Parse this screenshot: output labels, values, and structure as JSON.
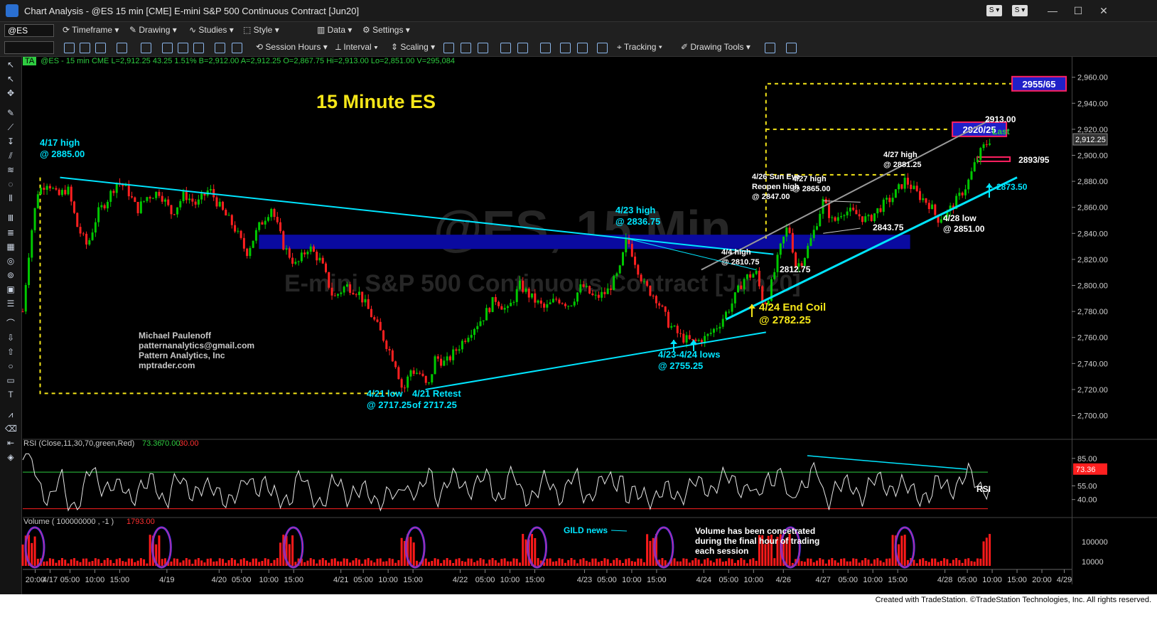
{
  "window": {
    "title": "Chart Analysis - @ES 15 min [CME] E-mini S&P 500 Continuous Contract [Jun20]"
  },
  "toolbar1": {
    "symbol": "@ES",
    "timeframe": "Timeframe",
    "drawing": "Drawing",
    "studies": "Studies",
    "style": "Style",
    "data": "Data",
    "settings": "Settings"
  },
  "toolbar2": {
    "session_hours": "Session Hours",
    "interval": "Interval",
    "scaling": "Scaling",
    "tracking": "Tracking",
    "drawing_tools": "Drawing Tools"
  },
  "status": {
    "tag": "TA",
    "text": "@ES - 15 min  CME  L=2,912.25  43.25  1.51%  B=2,912.00  A=2,912.25  O=2,867.75  Hi=2,913.00  Lo=2,851.00  V=295,084"
  },
  "footer": {
    "credit": "Created with TradeStation. ©TradeStation Technologies, Inc. All rights reserved."
  },
  "chart_data": [
    {
      "type": "line",
      "title": "15 Minute ES",
      "watermark_symbol": "@ES, 15 Min",
      "watermark_name": "E-mini S&P 500 Continuous Contract [Jun20]",
      "colors": {
        "up": "#00c800",
        "down": "#ff2020",
        "trendline": "#00e5ff",
        "zone": "#0a0aa0",
        "target": "#f5e619",
        "annotation": "#00e5ff"
      },
      "ylim": [
        2685,
        2968
      ],
      "y_ticks": [
        "2,960.00",
        "2,940.00",
        "2,920.00",
        "2,900.00",
        "2,880.00",
        "2,860.00",
        "2,840.00",
        "2,820.00",
        "2,800.00",
        "2,780.00",
        "2,760.00",
        "2,740.00",
        "2,720.00",
        "2,700.00"
      ],
      "y_tick_values": [
        2960,
        2940,
        2920,
        2900,
        2880,
        2860,
        2840,
        2820,
        2800,
        2780,
        2760,
        2740,
        2720,
        2700
      ],
      "x_ticks": [
        {
          "label": "20:00",
          "x": 0.05
        },
        {
          "label": "4/17",
          "x": 0.11
        },
        {
          "label": "05:00",
          "x": 0.19
        },
        {
          "label": "10:00",
          "x": 0.29
        },
        {
          "label": "15:00",
          "x": 0.39
        },
        {
          "label": "4/19",
          "x": 0.58
        },
        {
          "label": "4/20",
          "x": 0.79
        },
        {
          "label": "05:00",
          "x": 0.88
        },
        {
          "label": "10:00",
          "x": 0.99
        },
        {
          "label": "15:00",
          "x": 1.09
        },
        {
          "label": "4/21",
          "x": 1.28
        },
        {
          "label": "05:00",
          "x": 1.37
        },
        {
          "label": "10:00",
          "x": 1.47
        },
        {
          "label": "15:00",
          "x": 1.57
        },
        {
          "label": "4/22",
          "x": 1.76
        },
        {
          "label": "05:00",
          "x": 1.86
        },
        {
          "label": "10:00",
          "x": 1.96
        },
        {
          "label": "15:00",
          "x": 2.06
        },
        {
          "label": "4/23",
          "x": 2.26
        },
        {
          "label": "05:00",
          "x": 2.35
        },
        {
          "label": "10:00",
          "x": 2.45
        },
        {
          "label": "15:00",
          "x": 2.55
        },
        {
          "label": "4/24",
          "x": 2.74
        },
        {
          "label": "05:00",
          "x": 2.84
        },
        {
          "label": "10:00",
          "x": 2.94
        },
        {
          "label": "4/26",
          "x": 3.06
        },
        {
          "label": "4/27",
          "x": 3.22
        },
        {
          "label": "05:00",
          "x": 3.32
        },
        {
          "label": "10:00",
          "x": 3.42
        },
        {
          "label": "15:00",
          "x": 3.52
        },
        {
          "label": "4/28",
          "x": 3.71
        },
        {
          "label": "05:00",
          "x": 3.8
        },
        {
          "label": "10:00",
          "x": 3.9
        },
        {
          "label": "15:00",
          "x": 4.0
        },
        {
          "label": "20:00",
          "x": 4.1
        },
        {
          "label": "4/29",
          "x": 4.19
        }
      ],
      "price_path": [
        [
          0.0,
          2780
        ],
        [
          0.03,
          2835
        ],
        [
          0.06,
          2872
        ],
        [
          0.1,
          2880
        ],
        [
          0.14,
          2868
        ],
        [
          0.18,
          2875
        ],
        [
          0.22,
          2845
        ],
        [
          0.26,
          2830
        ],
        [
          0.3,
          2855
        ],
        [
          0.34,
          2866
        ],
        [
          0.38,
          2880
        ],
        [
          0.42,
          2874
        ],
        [
          0.46,
          2858
        ],
        [
          0.5,
          2868
        ],
        [
          0.55,
          2872
        ],
        [
          0.6,
          2855
        ],
        [
          0.65,
          2870
        ],
        [
          0.7,
          2862
        ],
        [
          0.75,
          2874
        ],
        [
          0.8,
          2858
        ],
        [
          0.85,
          2845
        ],
        [
          0.9,
          2825
        ],
        [
          0.95,
          2845
        ],
        [
          1.0,
          2860
        ],
        [
          1.05,
          2830
        ],
        [
          1.1,
          2815
        ],
        [
          1.15,
          2830
        ],
        [
          1.2,
          2818
        ],
        [
          1.25,
          2790
        ],
        [
          1.3,
          2800
        ],
        [
          1.35,
          2795
        ],
        [
          1.4,
          2778
        ],
        [
          1.45,
          2760
        ],
        [
          1.5,
          2740
        ],
        [
          1.53,
          2718
        ],
        [
          1.56,
          2735
        ],
        [
          1.6,
          2732
        ],
        [
          1.63,
          2720
        ],
        [
          1.66,
          2745
        ],
        [
          1.7,
          2740
        ],
        [
          1.75,
          2752
        ],
        [
          1.8,
          2765
        ],
        [
          1.85,
          2775
        ],
        [
          1.9,
          2790
        ],
        [
          1.95,
          2780
        ],
        [
          2.0,
          2800
        ],
        [
          2.05,
          2790
        ],
        [
          2.1,
          2782
        ],
        [
          2.15,
          2790
        ],
        [
          2.2,
          2785
        ],
        [
          2.25,
          2800
        ],
        [
          2.3,
          2790
        ],
        [
          2.35,
          2795
        ],
        [
          2.4,
          2810
        ],
        [
          2.43,
          2837
        ],
        [
          2.47,
          2815
        ],
        [
          2.5,
          2800
        ],
        [
          2.55,
          2790
        ],
        [
          2.6,
          2770
        ],
        [
          2.65,
          2760
        ],
        [
          2.7,
          2756
        ],
        [
          2.75,
          2760
        ],
        [
          2.8,
          2770
        ],
        [
          2.85,
          2785
        ],
        [
          2.9,
          2805
        ],
        [
          2.95,
          2810
        ],
        [
          2.98,
          2785
        ],
        [
          3.0,
          2792
        ],
        [
          3.05,
          2830
        ],
        [
          3.08,
          2847
        ],
        [
          3.11,
          2815
        ],
        [
          3.14,
          2820
        ],
        [
          3.18,
          2840
        ],
        [
          3.22,
          2865
        ],
        [
          3.26,
          2848
        ],
        [
          3.3,
          2858
        ],
        [
          3.35,
          2855
        ],
        [
          3.4,
          2850
        ],
        [
          3.45,
          2860
        ],
        [
          3.5,
          2868
        ],
        [
          3.55,
          2881
        ],
        [
          3.6,
          2870
        ],
        [
          3.65,
          2862
        ],
        [
          3.68,
          2851
        ],
        [
          3.72,
          2856
        ],
        [
          3.76,
          2866
        ],
        [
          3.8,
          2878
        ],
        [
          3.83,
          2893
        ],
        [
          3.86,
          2905
        ],
        [
          3.89,
          2912
        ]
      ],
      "zones": [
        {
          "y_low": 2828,
          "y_high": 2839,
          "x_start": 0.95,
          "x_end": 3.57
        }
      ],
      "trendlines": [
        {
          "name": "upper downtrend",
          "from": [
            0.15,
            2883
          ],
          "to": [
            3.02,
            2824
          ]
        },
        {
          "name": "lower uptrend",
          "from": [
            1.62,
            2720
          ],
          "to": [
            2.99,
            2764
          ]
        },
        {
          "name": "steep uptrend",
          "from": [
            2.83,
            2774
          ],
          "to": [
            4.0,
            2883
          ]
        },
        {
          "name": "upper channel",
          "from": [
            2.73,
            2812
          ],
          "to": [
            3.89,
            2927
          ]
        }
      ],
      "targets": [
        {
          "label": "2955/65",
          "y": 2955
        },
        {
          "label": "2920/25",
          "y": 2920
        },
        {
          "label": "2893/95",
          "y": 2897
        }
      ],
      "annotations": [
        {
          "text": "4/17 high\n@ 2885.00",
          "x": 0.15,
          "y": 2885
        },
        {
          "text": "4/21 low\n@ 2717.25",
          "x": 1.53,
          "y": 2717.25
        },
        {
          "text": "4/21 Retest\nof 2717.25",
          "x": 1.63,
          "y": 2717.25
        },
        {
          "text": "4/23 high\n@ 2836.75",
          "x": 2.43,
          "y": 2836.75
        },
        {
          "text": "4/23-4/24 lows\n@ 2755.25",
          "x": 2.7,
          "y": 2755.25
        },
        {
          "text": "4/4 high\n@ 2810.75",
          "x": 2.95,
          "y": 2810.75
        },
        {
          "text": "4/24 End Coil\n@ 2782.25",
          "x": 3.0,
          "y": 2782.25
        },
        {
          "text": "4/26 Sun Eve\nReopen high\n@ 2847.00",
          "x": 3.08,
          "y": 2847
        },
        {
          "text": "2812.75",
          "x": 3.11,
          "y": 2812.75
        },
        {
          "text": "4/27 high\n@ 2865.00",
          "x": 3.22,
          "y": 2865
        },
        {
          "text": "2843.75",
          "x": 3.3,
          "y": 2843.75
        },
        {
          "text": "4/27 high\n@ 2881.25",
          "x": 3.55,
          "y": 2881.25
        },
        {
          "text": "4/28 low\n@ 2851.00",
          "x": 3.68,
          "y": 2851
        },
        {
          "text": "2873.50",
          "x": 3.98,
          "y": 2873.5
        },
        {
          "text": "2913.00",
          "x": 3.89,
          "y": 2913
        },
        {
          "text": "Last",
          "x": 3.89,
          "y": 2910
        }
      ],
      "last_price": "2,912.25",
      "author": [
        "Michael Paulenoff",
        "patternanalytics@gmail.com",
        "Pattern Analytics, Inc",
        "mptrader.com"
      ]
    },
    {
      "type": "line",
      "title": "RSI (Close,11,30,70,green,Red)",
      "values_printed": [
        "73.36",
        "70.00",
        "30.00"
      ],
      "ylim": [
        25,
        95
      ],
      "y_ticks": [
        "85.00",
        "55.00",
        "40.00"
      ],
      "y_tick_values": [
        85,
        55,
        40
      ],
      "overbought": 70,
      "oversold": 30,
      "last_value": "73.36",
      "label": "RSI"
    },
    {
      "type": "bar",
      "title": "Volume ( 100000000 , -1 )",
      "last_value": "1793.00",
      "y_ticks": [
        "100000",
        "10000"
      ],
      "annotations": [
        "GILD news",
        "Volume has been concetrated\nduring the final hour of trading\neach session"
      ]
    }
  ]
}
